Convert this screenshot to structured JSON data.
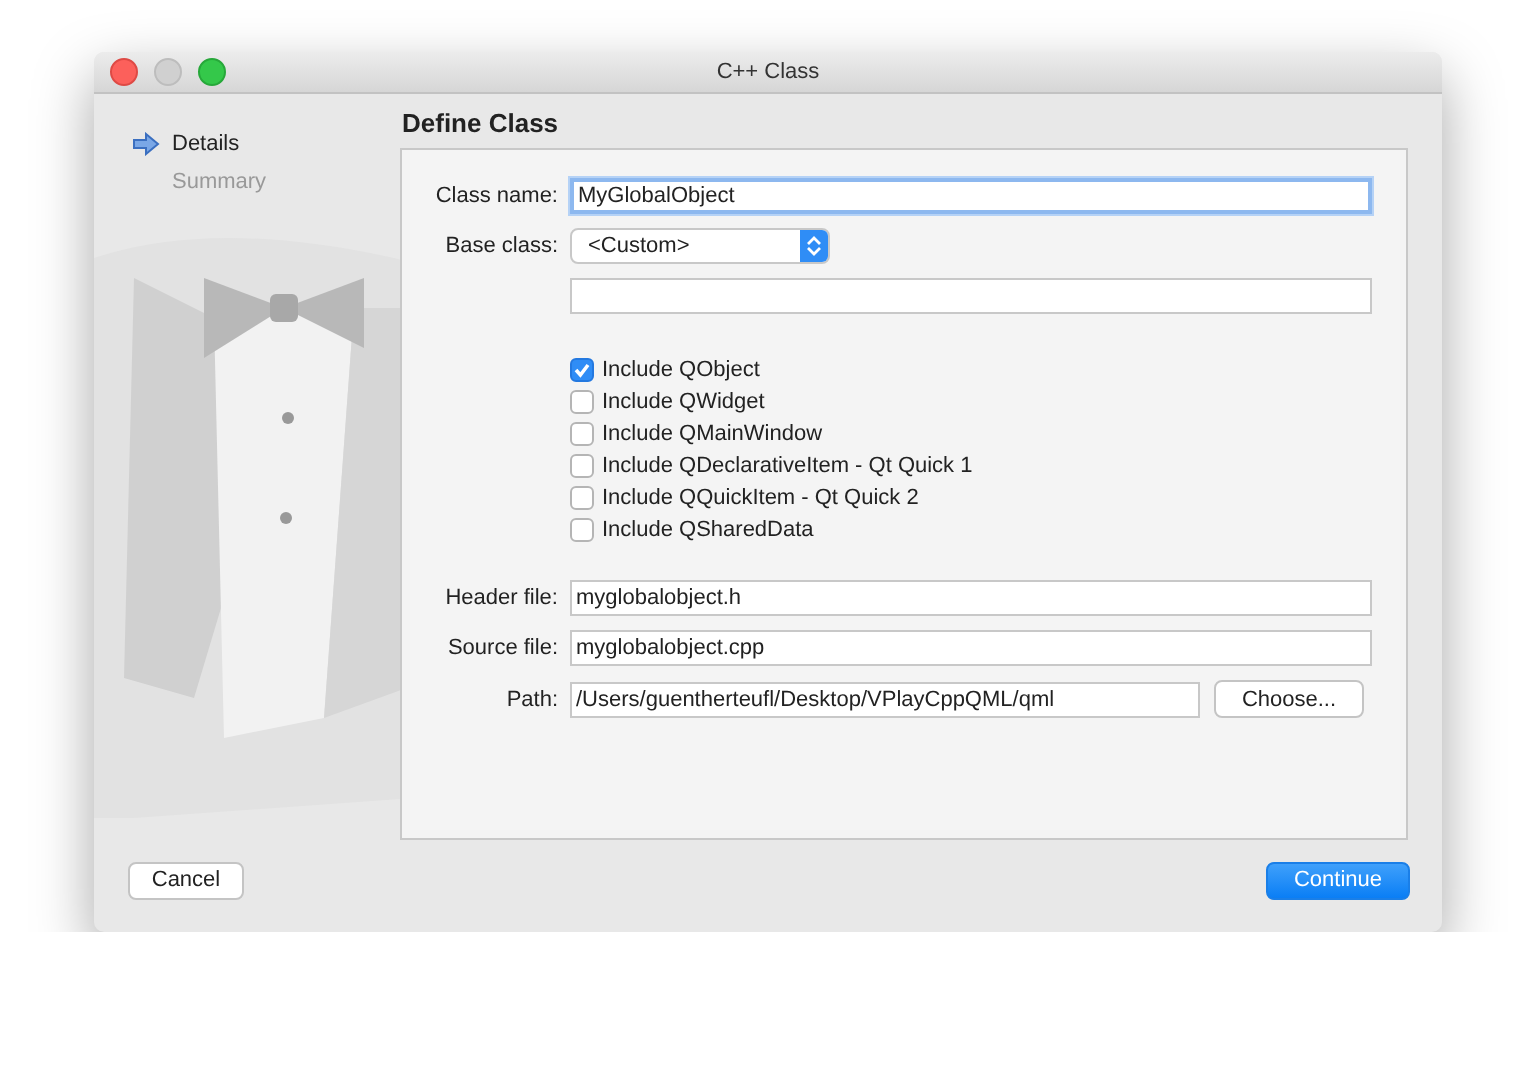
{
  "window": {
    "title": "C++ Class"
  },
  "steps": [
    {
      "label": "Details",
      "selected": true
    },
    {
      "label": "Summary",
      "selected": false
    }
  ],
  "page_title": "Define Class",
  "class_fields": [
    {
      "kind": "text",
      "label": "Class name:",
      "value": "MyGlobalObject",
      "focused": true
    },
    {
      "kind": "select",
      "label": "Base class:",
      "value": "<Custom>"
    },
    {
      "kind": "text",
      "focused": false
    }
  ],
  "options": [
    {
      "label": "Include QObject",
      "checked": true
    },
    {
      "label": "Include QWidget",
      "checked": false
    },
    {
      "label": "Include QMainWindow",
      "checked": false
    },
    {
      "label": "Include QDeclarativeItem - Qt Quick 1",
      "checked": false
    },
    {
      "label": "Include QQuickItem - Qt Quick 2",
      "checked": false
    },
    {
      "label": "Include QSharedData",
      "checked": false
    }
  ],
  "file_fields": [
    {
      "kind": "text",
      "label": "Header file:",
      "value": "myglobalobject.h",
      "focused": false
    },
    {
      "kind": "text",
      "label": "Source file:",
      "value": "myglobalobject.cpp",
      "focused": false
    },
    {
      "kind": "path",
      "label": "Path:",
      "value": "/Users/guentherteufl/Desktop/VPlayCppQML/qml",
      "button": "Choose..."
    }
  ],
  "buttons": {
    "cancel": "Cancel",
    "continue": "Continue"
  }
}
